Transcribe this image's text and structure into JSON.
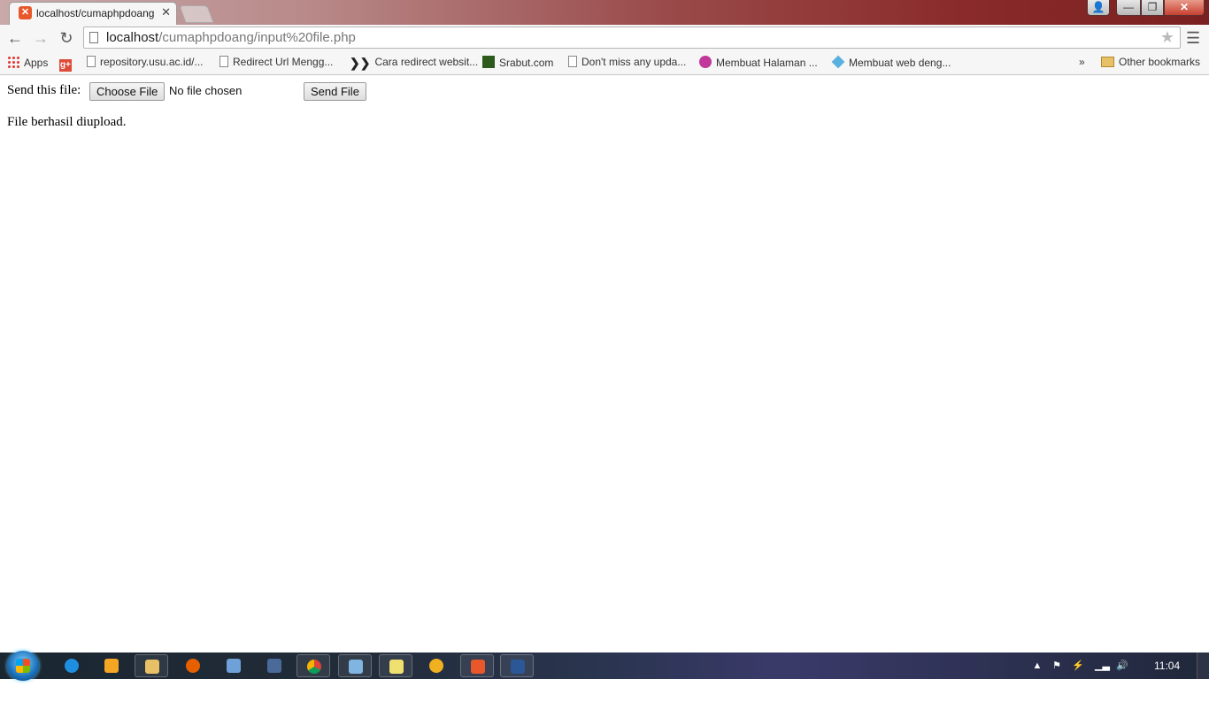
{
  "browser": {
    "active_tab_title": "localhost/cumaphpdoang",
    "url_host": "localhost",
    "url_path": "/cumaphpdoang/input%20file.php",
    "window_controls": {
      "user": "👤",
      "minimize": "—",
      "maximize": "❐",
      "close": "✕"
    }
  },
  "bookmarks": {
    "items": [
      {
        "label": "Apps",
        "icon": "apps-grid-icon"
      },
      {
        "label": "",
        "icon": "google-plus-icon"
      },
      {
        "label": "repository.usu.ac.id/...",
        "icon": "page-icon"
      },
      {
        "label": "Redirect Url Mengg...",
        "icon": "page-icon"
      },
      {
        "label": "Cara redirect websit...",
        "icon": "chevron-icon"
      },
      {
        "label": "Srabut.com",
        "icon": "srabut-icon"
      },
      {
        "label": "Don't miss any upda...",
        "icon": "page-icon"
      },
      {
        "label": "Membuat Halaman ...",
        "icon": "pink-circle-icon"
      },
      {
        "label": "Membuat web deng...",
        "icon": "diamond-icon"
      }
    ],
    "overflow": "»",
    "other_label": "Other bookmarks"
  },
  "page": {
    "send_label": "Send this file:",
    "choose_button": "Choose File",
    "no_file_text": "No file chosen",
    "send_button": "Send File",
    "status_text": "File berhasil diupload."
  },
  "taskbar": {
    "apps": [
      "ie-icon",
      "media-player-icon",
      "explorer-icon",
      "firefox-icon",
      "notepad-icon",
      "network-icon",
      "chrome-icon",
      "paint-icon",
      "sticky-notes-icon",
      "bee-icon",
      "xampp-icon",
      "word-icon"
    ],
    "clock": "11:04"
  },
  "colors": {
    "accent_favicon": "#e8582a",
    "close_button": "#c84030"
  }
}
